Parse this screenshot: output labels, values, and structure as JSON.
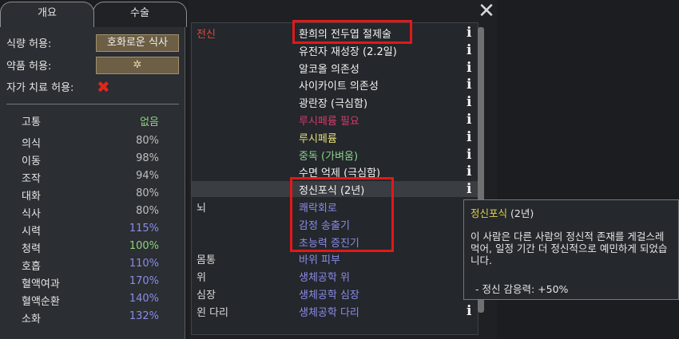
{
  "tabs": [
    {
      "label": "개요"
    },
    {
      "label": "수술"
    }
  ],
  "prefs": {
    "food_label": "식량 허용:",
    "food_value": "호화로운 식사",
    "drug_label": "약품 허용:",
    "drug_value": "✲",
    "self_tend_label": "자가 치료 허용:",
    "self_tend_value": "✖"
  },
  "capacities": [
    {
      "name": "고통",
      "value": "없음",
      "color": "#8fd27e"
    },
    {
      "name": "의식",
      "value": "80%",
      "color": "#bfbfbf"
    },
    {
      "name": "이동",
      "value": "98%",
      "color": "#bfbfbf"
    },
    {
      "name": "조작",
      "value": "94%",
      "color": "#bfbfbf"
    },
    {
      "name": "대화",
      "value": "80%",
      "color": "#bfbfbf"
    },
    {
      "name": "식사",
      "value": "80%",
      "color": "#bfbfbf"
    },
    {
      "name": "시력",
      "value": "115%",
      "color": "#8b8ce8"
    },
    {
      "name": "청력",
      "value": "100%",
      "color": "#8fd27e"
    },
    {
      "name": "호흡",
      "value": "110%",
      "color": "#8b8ce8"
    },
    {
      "name": "혈액여과",
      "value": "170%",
      "color": "#8b8ce8"
    },
    {
      "name": "혈액순환",
      "value": "140%",
      "color": "#8b8ce8"
    },
    {
      "name": "소화",
      "value": "132%",
      "color": "#8b8ce8"
    }
  ],
  "body_parts": [
    {
      "name": "전신",
      "color": "#e8443a"
    },
    {
      "name": "뇌",
      "color": "#d8d8d8"
    },
    {
      "name": "몸통",
      "color": "#d8d8d8"
    },
    {
      "name": "위",
      "color": "#d8d8d8"
    },
    {
      "name": "심장",
      "color": "#d8d8d8"
    },
    {
      "name": "왼 다리",
      "color": "#d8d8d8"
    }
  ],
  "hediffs": [
    {
      "name": "환희의 전두엽 절제술",
      "color": "#f2f2f2",
      "info": "i"
    },
    {
      "name": "유전자 재성장 (2.2일)",
      "color": "#f2f2f2",
      "info": "i"
    },
    {
      "name": "알코올 의존성",
      "color": "#f2f2f2",
      "info": "i"
    },
    {
      "name": "사이카이트 의존성",
      "color": "#f2f2f2",
      "info": "i"
    },
    {
      "name": "광란장 (극심함)",
      "color": "#f2f2f2",
      "info": "i"
    },
    {
      "name": "루시페륨 필요",
      "color": "#d8386c",
      "info": "i"
    },
    {
      "name": "루시페륨",
      "color": "#e6df7a",
      "info": "i"
    },
    {
      "name": "중독 (가벼움)",
      "color": "#86d48a",
      "info": "i"
    },
    {
      "name": "수면 억제 (극심함)",
      "color": "#f2f2f2",
      "info": "i"
    },
    {
      "name": "정신포식 (2년)",
      "color": "#f2f2f2",
      "info": "i"
    },
    {
      "name": "쾌락회로",
      "color": "#8b8ce8",
      "info": "i"
    },
    {
      "name": "감정 송출기",
      "color": "#8b8ce8",
      "info": "i"
    },
    {
      "name": "초능력 증진기",
      "color": "#8b8ce8",
      "info": "i"
    },
    {
      "name": "바위 피부",
      "color": "#8b8ce8",
      "info": "i"
    },
    {
      "name": "생체공학 위",
      "color": "#8b8ce8",
      "info": "i"
    },
    {
      "name": "생체공학 심장",
      "color": "#8b8ce8",
      "info": "i"
    },
    {
      "name": "생체공학 다리",
      "color": "#8b8ce8",
      "info": "i"
    }
  ],
  "tooltip": {
    "title": "정신포식",
    "title_suffix": "(2년)",
    "body": "이 사람은 다른 사람의 정신적 존재를 게걸스레 먹어, 일정 기간 더 정신적으로 예민하게 되었습니다.",
    "effect": "- 정신 감응력: +50%"
  },
  "close_label": "✕"
}
